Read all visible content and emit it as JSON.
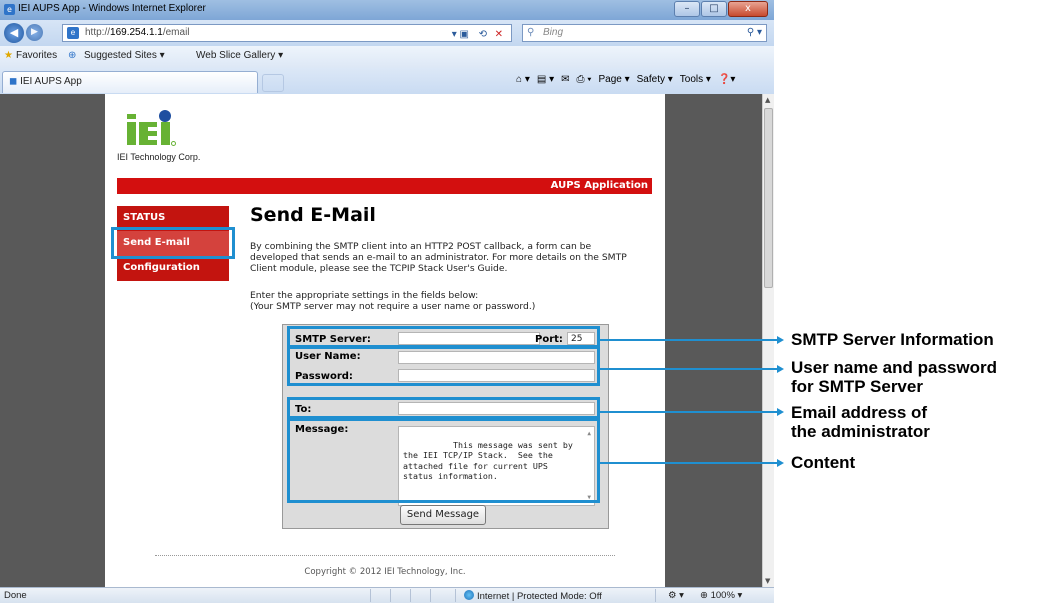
{
  "window": {
    "title": "IEI AUPS App - Windows Internet Explorer",
    "controls": [
      "–",
      "□",
      "x"
    ]
  },
  "address": {
    "prefix": "http://",
    "host": "169.254.1.1",
    "path": "/email"
  },
  "search": {
    "placeholder": "Bing"
  },
  "favorites_bar": {
    "favorites": "Favorites",
    "suggested": "Suggested Sites ▾",
    "slice": "Web Slice Gallery ▾"
  },
  "tab": {
    "title": "IEI AUPS App"
  },
  "command_bar": {
    "page": "Page ▾",
    "safety": "Safety ▾",
    "tools": "Tools ▾"
  },
  "page": {
    "company": "IEI Technology Corp.",
    "banner": "AUPS Application",
    "nav": [
      "STATUS",
      "Send E-mail",
      "Configuration"
    ],
    "heading": "Send E-Mail",
    "para1": "By combining the SMTP client into an HTTP2 POST callback, a form can be developed that sends an e-mail to an administrator. For more details on the SMTP Client module, please see the TCPIP Stack User's Guide.",
    "para2": "Enter the appropriate settings in the fields below:\n(Your SMTP server may not require a user name or password.)",
    "form": {
      "smtp_server_label": "SMTP Server:",
      "smtp_server_value": "",
      "port_label": "Port:",
      "port_value": "25",
      "username_label": "User Name:",
      "password_label": "Password:",
      "to_label": "To:",
      "message_label": "Message:",
      "message_value": "This message was sent by the IEI TCP/IP Stack.  See the attached file for current UPS status information.",
      "send_button": "Send Message"
    },
    "copyright": "Copyright © 2012 IEI Technology, Inc."
  },
  "status_bar": {
    "left": "Done",
    "zone": "Internet | Protected Mode: Off",
    "zoom": "100%"
  },
  "annotations": {
    "smtp": "SMTP Server Information",
    "credentials": "User name and password\nfor SMTP Server",
    "email": "Email address of\nthe administrator",
    "content": "Content"
  },
  "colors": {
    "accent_red": "#d30f0f",
    "callout_blue": "#1f8fd0",
    "logo_green": "#67b234",
    "logo_blue": "#1e4ea0"
  }
}
